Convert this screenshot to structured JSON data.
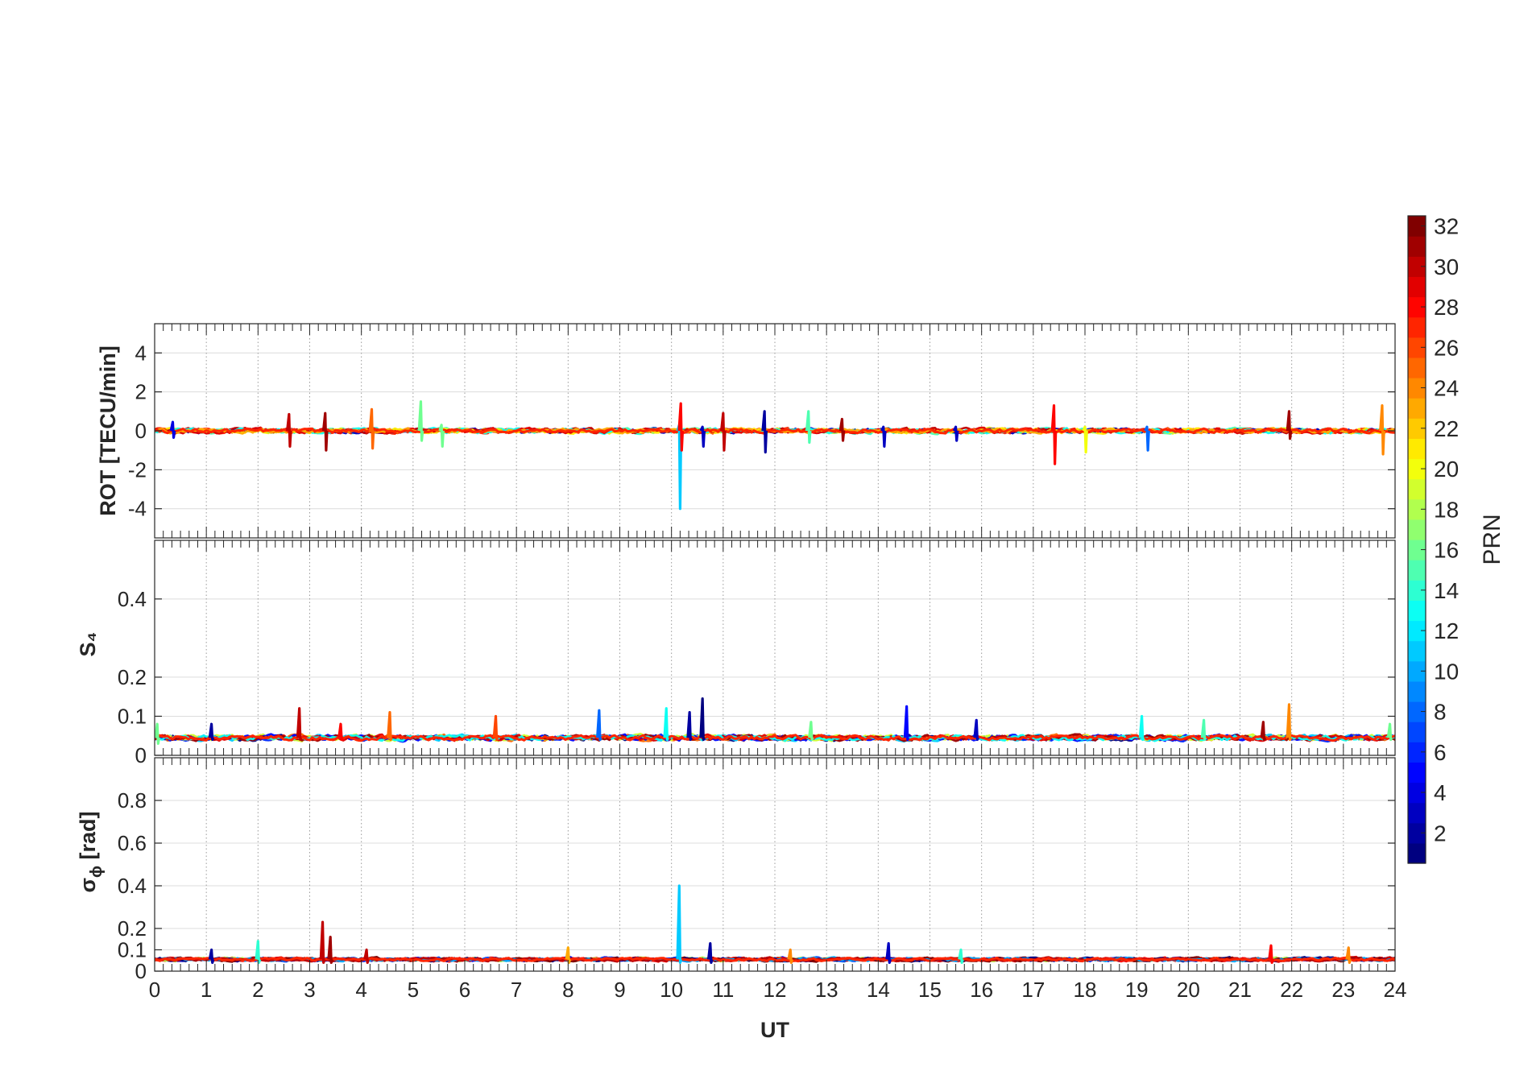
{
  "chart_data": [
    {
      "type": "line",
      "panel": "ROT",
      "ylabel": "ROT [TECU/min]",
      "ylim": [
        -5.5,
        5.5
      ],
      "yticks": [
        -4,
        -2,
        0,
        2,
        4
      ],
      "ytick_labels": [
        "-4",
        "-2",
        "0",
        "2",
        "4"
      ],
      "xlim": [
        0,
        24
      ],
      "grid": true,
      "baseline": 0.0,
      "noise": 0.18,
      "spikes": [
        {
          "x": 0.35,
          "lo": -0.35,
          "hi": 0.45,
          "prn": 4
        },
        {
          "x": 2.6,
          "lo": -0.8,
          "hi": 0.85,
          "prn": 30
        },
        {
          "x": 3.3,
          "lo": -1.0,
          "hi": 0.9,
          "prn": 31
        },
        {
          "x": 4.2,
          "lo": -0.9,
          "hi": 1.1,
          "prn": 25
        },
        {
          "x": 5.15,
          "lo": -0.5,
          "hi": 1.5,
          "prn": 16
        },
        {
          "x": 5.55,
          "lo": -0.8,
          "hi": 0.3,
          "prn": 16
        },
        {
          "x": 10.15,
          "lo": -4.0,
          "hi": 0.3,
          "prn": 11
        },
        {
          "x": 10.18,
          "lo": -1.0,
          "hi": 1.4,
          "prn": 28
        },
        {
          "x": 10.6,
          "lo": -0.8,
          "hi": 0.2,
          "prn": 3
        },
        {
          "x": 11.0,
          "lo": -1.0,
          "hi": 0.9,
          "prn": 30
        },
        {
          "x": 11.8,
          "lo": -1.1,
          "hi": 1.0,
          "prn": 2
        },
        {
          "x": 12.65,
          "lo": -0.6,
          "hi": 1.0,
          "prn": 15
        },
        {
          "x": 13.3,
          "lo": -0.5,
          "hi": 0.6,
          "prn": 31
        },
        {
          "x": 14.1,
          "lo": -0.8,
          "hi": 0.2,
          "prn": 3
        },
        {
          "x": 15.5,
          "lo": -0.5,
          "hi": 0.2,
          "prn": 3
        },
        {
          "x": 17.4,
          "lo": -1.7,
          "hi": 1.3,
          "prn": 28
        },
        {
          "x": 18.0,
          "lo": -1.1,
          "hi": 0.2,
          "prn": 20
        },
        {
          "x": 19.2,
          "lo": -1.0,
          "hi": 0.2,
          "prn": 8
        },
        {
          "x": 21.95,
          "lo": -0.4,
          "hi": 1.0,
          "prn": 31
        },
        {
          "x": 23.75,
          "lo": -1.2,
          "hi": 1.3,
          "prn": 24
        }
      ]
    },
    {
      "type": "line",
      "panel": "S4",
      "ylabel": "S₄",
      "ylim": [
        0,
        0.55
      ],
      "yticks": [
        0,
        0.1,
        0.2,
        0.4
      ],
      "ytick_labels": [
        "0",
        "0.1",
        "0.2",
        "0.4"
      ],
      "xlim": [
        0,
        24
      ],
      "grid": true,
      "baseline": 0.045,
      "noise": 0.01,
      "spikes": [
        {
          "x": 0.05,
          "lo": 0.03,
          "hi": 0.08,
          "prn": 16
        },
        {
          "x": 1.1,
          "lo": 0.04,
          "hi": 0.08,
          "prn": 2
        },
        {
          "x": 2.8,
          "lo": 0.04,
          "hi": 0.12,
          "prn": 30
        },
        {
          "x": 3.6,
          "lo": 0.04,
          "hi": 0.08,
          "prn": 28
        },
        {
          "x": 4.55,
          "lo": 0.04,
          "hi": 0.11,
          "prn": 25
        },
        {
          "x": 6.6,
          "lo": 0.04,
          "hi": 0.1,
          "prn": 26
        },
        {
          "x": 8.6,
          "lo": 0.04,
          "hi": 0.115,
          "prn": 8
        },
        {
          "x": 9.9,
          "lo": 0.04,
          "hi": 0.12,
          "prn": 13
        },
        {
          "x": 10.35,
          "lo": 0.04,
          "hi": 0.11,
          "prn": 2
        },
        {
          "x": 10.6,
          "lo": 0.04,
          "hi": 0.145,
          "prn": 1
        },
        {
          "x": 12.7,
          "lo": 0.04,
          "hi": 0.085,
          "prn": 16
        },
        {
          "x": 14.55,
          "lo": 0.04,
          "hi": 0.125,
          "prn": 5
        },
        {
          "x": 15.9,
          "lo": 0.04,
          "hi": 0.09,
          "prn": 3
        },
        {
          "x": 19.1,
          "lo": 0.04,
          "hi": 0.1,
          "prn": 13
        },
        {
          "x": 20.3,
          "lo": 0.04,
          "hi": 0.09,
          "prn": 15
        },
        {
          "x": 21.45,
          "lo": 0.04,
          "hi": 0.085,
          "prn": 31
        },
        {
          "x": 21.95,
          "lo": 0.04,
          "hi": 0.13,
          "prn": 24
        },
        {
          "x": 23.9,
          "lo": 0.04,
          "hi": 0.08,
          "prn": 16
        }
      ]
    },
    {
      "type": "line",
      "panel": "sigma_phi",
      "ylabel": "σ",
      "ylabel_sub": "ϕ",
      "ylabel_unit": " [rad]",
      "ylim": [
        0,
        1.0
      ],
      "yticks": [
        0,
        0.1,
        0.2,
        0.4,
        0.6,
        0.8
      ],
      "ytick_labels": [
        "0",
        "0.1",
        "0.2",
        "0.4",
        "0.6",
        "0.8"
      ],
      "xlim": [
        0,
        24
      ],
      "xticks": [
        0,
        1,
        2,
        3,
        4,
        5,
        6,
        7,
        8,
        9,
        10,
        11,
        12,
        13,
        14,
        15,
        16,
        17,
        18,
        19,
        20,
        21,
        22,
        23,
        24
      ],
      "xtick_labels": [
        "0",
        "1",
        "2",
        "3",
        "4",
        "5",
        "6",
        "7",
        "8",
        "9",
        "10",
        "11",
        "12",
        "13",
        "14",
        "15",
        "16",
        "17",
        "18",
        "19",
        "20",
        "21",
        "22",
        "23",
        "24"
      ],
      "xlabel": "UT",
      "grid": true,
      "baseline": 0.055,
      "noise": 0.012,
      "spikes": [
        {
          "x": 1.1,
          "lo": 0.04,
          "hi": 0.1,
          "prn": 2
        },
        {
          "x": 2.0,
          "lo": 0.04,
          "hi": 0.14,
          "prn": 14
        },
        {
          "x": 3.25,
          "lo": 0.04,
          "hi": 0.23,
          "prn": 30
        },
        {
          "x": 3.4,
          "lo": 0.04,
          "hi": 0.16,
          "prn": 31
        },
        {
          "x": 4.1,
          "lo": 0.04,
          "hi": 0.1,
          "prn": 30
        },
        {
          "x": 8.0,
          "lo": 0.04,
          "hi": 0.11,
          "prn": 23
        },
        {
          "x": 10.15,
          "lo": 0.04,
          "hi": 0.4,
          "prn": 11
        },
        {
          "x": 10.75,
          "lo": 0.04,
          "hi": 0.13,
          "prn": 2
        },
        {
          "x": 12.3,
          "lo": 0.04,
          "hi": 0.1,
          "prn": 24
        },
        {
          "x": 14.2,
          "lo": 0.04,
          "hi": 0.13,
          "prn": 3
        },
        {
          "x": 15.6,
          "lo": 0.04,
          "hi": 0.1,
          "prn": 14
        },
        {
          "x": 21.6,
          "lo": 0.04,
          "hi": 0.12,
          "prn": 28
        },
        {
          "x": 23.1,
          "lo": 0.04,
          "hi": 0.11,
          "prn": 24
        }
      ]
    }
  ],
  "colorbar": {
    "label": "PRN",
    "colormap": "jet",
    "range": [
      1,
      32
    ],
    "ticks": [
      2,
      4,
      6,
      8,
      10,
      12,
      14,
      16,
      18,
      20,
      22,
      24,
      26,
      28,
      30,
      32
    ],
    "tick_labels": [
      "2",
      "4",
      "6",
      "8",
      "10",
      "12",
      "14",
      "16",
      "18",
      "20",
      "22",
      "24",
      "26",
      "28",
      "30",
      "32"
    ]
  },
  "colors": {
    "axis": "#262626",
    "grid": "#dcdcdc",
    "minor_grid": "#bdbdbd"
  }
}
